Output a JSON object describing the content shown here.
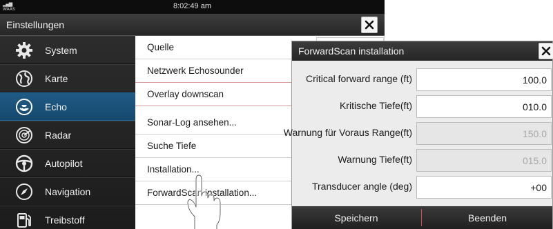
{
  "status_bar": {
    "signal_label": "WAAS",
    "time": "8:02:49 am"
  },
  "window": {
    "title": "Einstellungen",
    "close_icon": "close-icon"
  },
  "sidebar": {
    "items": [
      {
        "label": "System",
        "icon": "gear-icon",
        "active": false
      },
      {
        "label": "Karte",
        "icon": "globe-icon",
        "active": false
      },
      {
        "label": "Echo",
        "icon": "echo-icon",
        "active": true
      },
      {
        "label": "Radar",
        "icon": "radar-icon",
        "active": false
      },
      {
        "label": "Autopilot",
        "icon": "steering-wheel-icon",
        "active": false
      },
      {
        "label": "Navigation",
        "icon": "compass-icon",
        "active": false
      },
      {
        "label": "Treibstoff",
        "icon": "fuel-icon",
        "active": false
      }
    ],
    "accent_color": "#1f5b86"
  },
  "echo_menu": {
    "items": [
      {
        "label": "Quelle"
      },
      {
        "label": "Netzwerk Echosounder"
      },
      {
        "label": "Overlay downscan"
      },
      {
        "label": "Sonar-Log ansehen..."
      },
      {
        "label": "Suche Tiefe"
      },
      {
        "label": "Installation..."
      },
      {
        "label": "ForwardScan installation..."
      }
    ]
  },
  "dialog": {
    "title": "ForwardScan installation",
    "fields": [
      {
        "label": "Critical forward range (ft)",
        "value": "100.0",
        "enabled": true
      },
      {
        "label": "Kritische Tiefe(ft)",
        "value": "010.0",
        "enabled": true
      },
      {
        "label": "Warnung für Voraus Range(ft)",
        "value": "150.0",
        "enabled": false
      },
      {
        "label": "Warnung Tiefe(ft)",
        "value": "015.0",
        "enabled": false
      },
      {
        "label": "Transducer angle (deg)",
        "value": "+00",
        "enabled": true
      }
    ],
    "save_label": "Speichern",
    "exit_label": "Beenden",
    "separator_color": "#d24a4a"
  }
}
